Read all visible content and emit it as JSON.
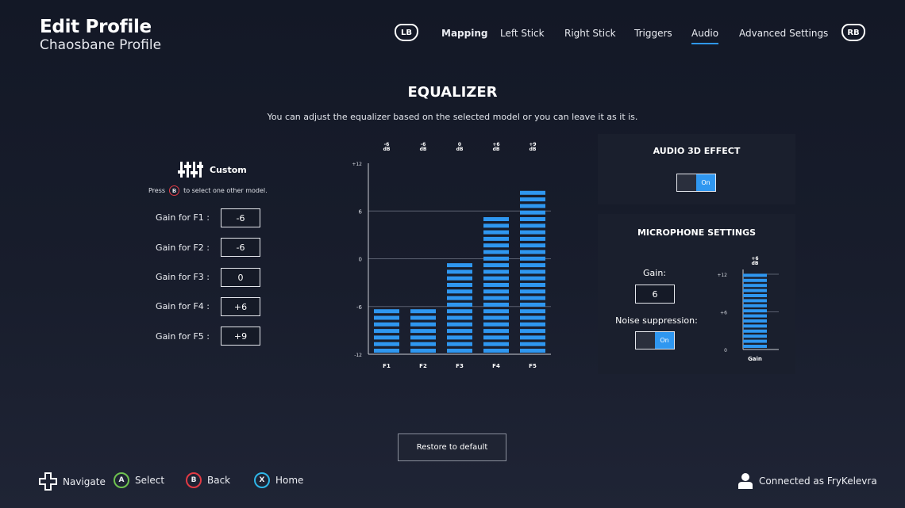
{
  "header": {
    "title": "Edit Profile",
    "subtitle": "Chaosbane Profile",
    "left_bumper": "LB",
    "right_bumper": "RB",
    "tabs": [
      {
        "label": "Mapping"
      },
      {
        "label": "Left Stick"
      },
      {
        "label": "Right Stick"
      },
      {
        "label": "Triggers"
      },
      {
        "label": "Audio",
        "active": true
      },
      {
        "label": "Advanced Settings"
      }
    ]
  },
  "equalizer": {
    "title": "EQUALIZER",
    "description": "You can adjust the equalizer based on the selected model or you can leave it as it is.",
    "model_icon": "sliders-icon",
    "model_label": "Custom",
    "press_text_before": "Press",
    "press_button": "B",
    "press_text_after": "to select one other model.",
    "gains": [
      {
        "label": "Gain for F1 :",
        "value": "-6"
      },
      {
        "label": "Gain for F2 :",
        "value": "-6"
      },
      {
        "label": "Gain for F3 :",
        "value": "0"
      },
      {
        "label": "Gain for F4 :",
        "value": "+6"
      },
      {
        "label": "Gain for F5 :",
        "value": "+9"
      }
    ]
  },
  "chart_data": {
    "type": "bar",
    "categories": [
      "F1",
      "F2",
      "F3",
      "F4",
      "F5"
    ],
    "values": [
      -6,
      -6,
      0,
      6,
      9
    ],
    "top_labels": [
      "-6",
      "-6",
      "0",
      "+6",
      "+9"
    ],
    "top_unit": "dB",
    "ylim": [
      -12,
      12
    ],
    "yticks": [
      "-12",
      "-6",
      "0",
      "6",
      "+12"
    ],
    "grid": true,
    "bar_color": "#2f97f0"
  },
  "audio3d": {
    "title": "AUDIO 3D EFFECT",
    "toggle_label": "On"
  },
  "microphone": {
    "title": "MICROPHONE SETTINGS",
    "gain_label": "Gain:",
    "gain_value": "6",
    "noise_label": "Noise suppression:",
    "noise_toggle": "On",
    "meter": {
      "top_value": "+6",
      "unit": "dB",
      "value": 6,
      "ylim": [
        0,
        12
      ],
      "yticks": [
        "0",
        "+6",
        "+12"
      ],
      "xlabel": "Gain"
    }
  },
  "footer": {
    "restore_label": "Restore to default",
    "hints": [
      {
        "button": "",
        "label": "Navigate",
        "icon": "dpad-icon"
      },
      {
        "button": "A",
        "label": "Select",
        "color": "#6ec14f"
      },
      {
        "button": "B",
        "label": "Back",
        "color": "#e23a44"
      },
      {
        "button": "X",
        "label": "Home",
        "color": "#2fb6e8"
      }
    ],
    "connection": "Connected as FryKelevra",
    "connection_icon": "user-icon"
  },
  "colors": {
    "accent": "#2f97f0",
    "background": "#161b28",
    "panel": "#1a1f2d"
  }
}
